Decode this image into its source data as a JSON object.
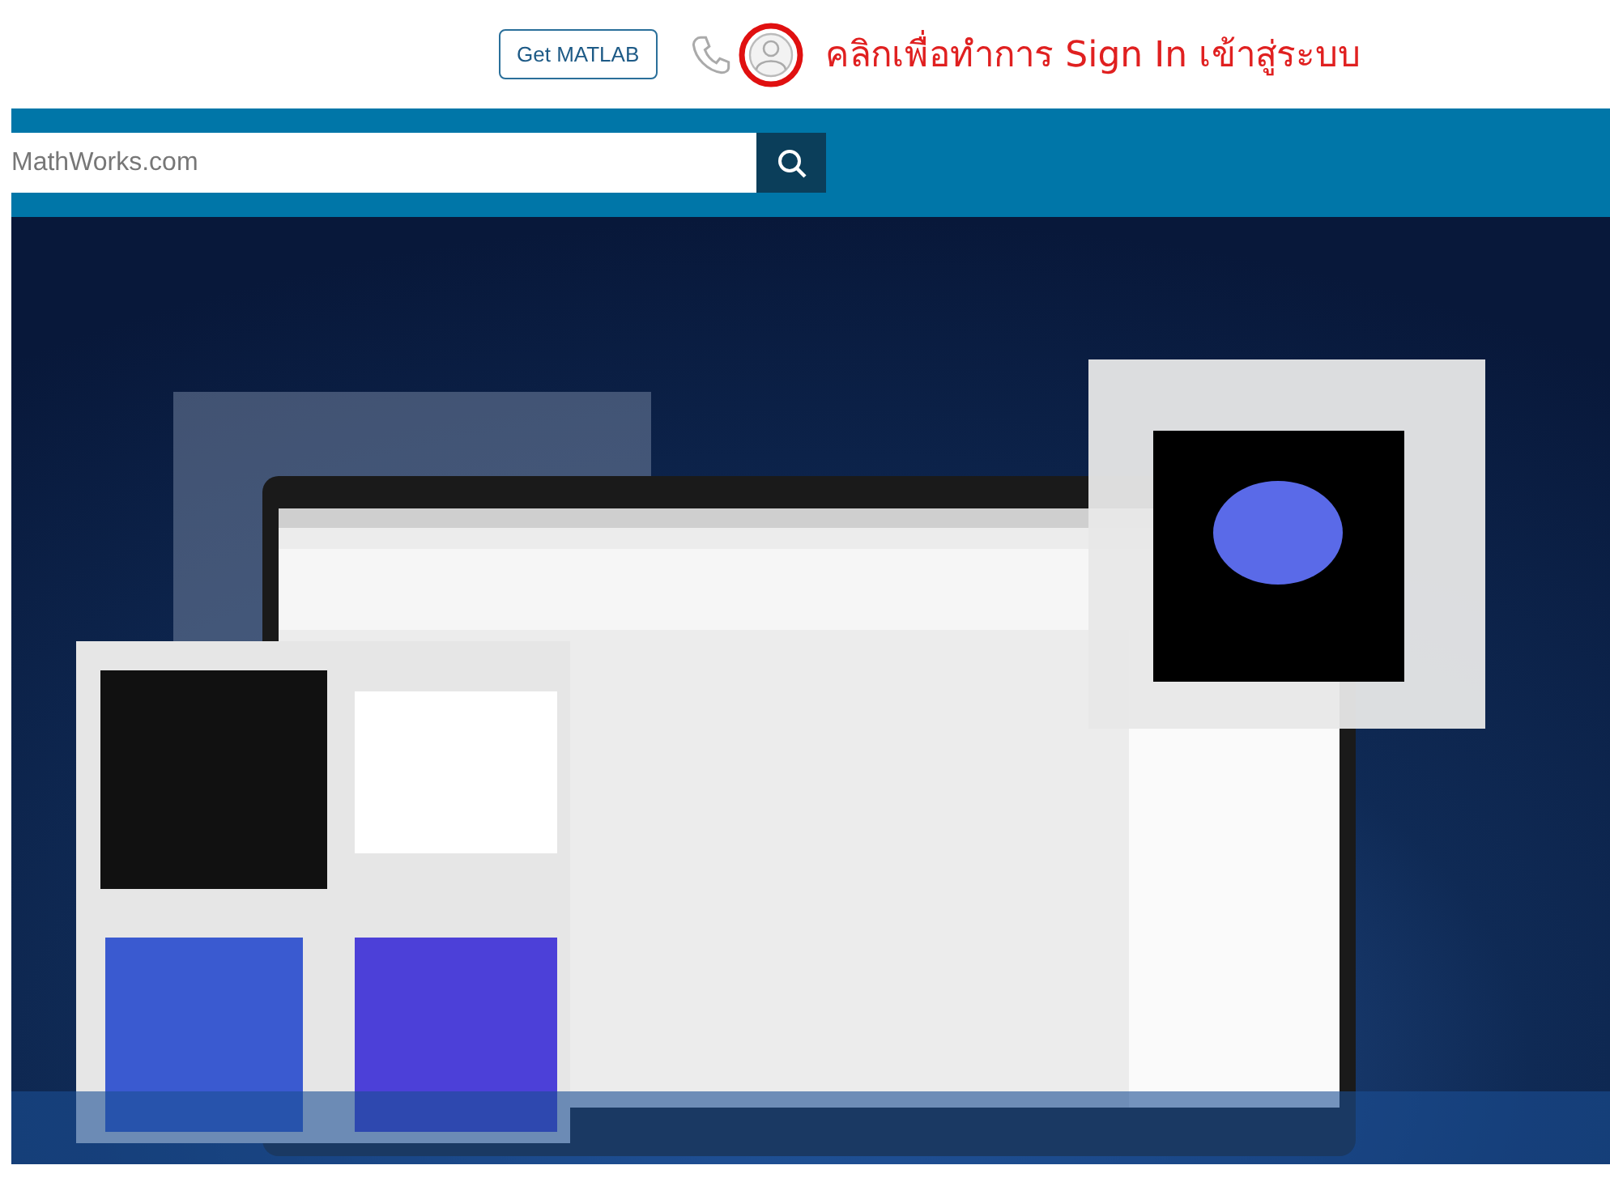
{
  "header": {
    "get_button": "Get MATLAB",
    "annotation": "คลิกเพื่อทำการ Sign In เข้าสู่ระบบ"
  },
  "search": {
    "placeholder": "MathWorks.com"
  }
}
